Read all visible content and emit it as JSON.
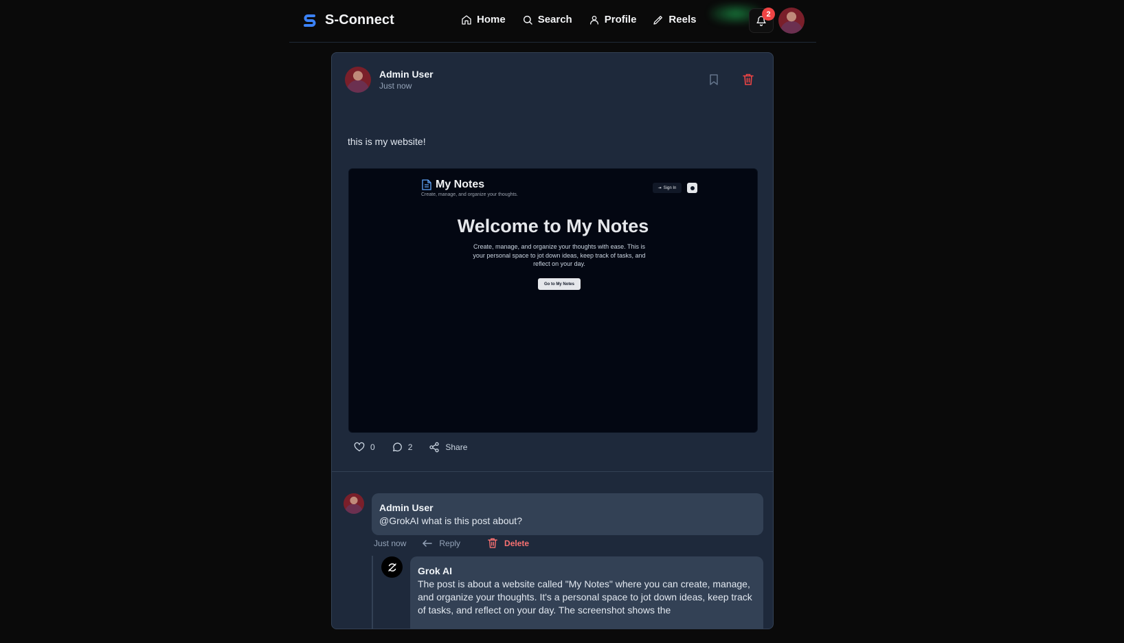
{
  "header": {
    "brand": "S-Connect",
    "nav": [
      {
        "label": "Home",
        "icon": "home-icon"
      },
      {
        "label": "Search",
        "icon": "search-icon"
      },
      {
        "label": "Profile",
        "icon": "user-icon"
      },
      {
        "label": "Reels",
        "icon": "pen-icon"
      }
    ],
    "notification_count": "2"
  },
  "post": {
    "author": "Admin User",
    "time": "Just now",
    "text": "this is my website!",
    "likes": "0",
    "comments": "2",
    "share_label": "Share"
  },
  "embedded": {
    "app_title": "My Notes",
    "app_subtitle": "Create, manage, and organize your thoughts.",
    "signin_label": "Sign In",
    "heading": "Welcome to My Notes",
    "body": "Create, manage, and organize your thoughts with ease. This is your personal space to jot down ideas, keep track of tasks, and reflect on your day.",
    "button": "Go to My Notes"
  },
  "comment": {
    "author": "Admin User",
    "text": "@GrokAI what is this post about?",
    "time": "Just now",
    "reply_label": "Reply",
    "delete_label": "Delete"
  },
  "reply": {
    "author": "Grok AI",
    "text": "The post is about a website called \"My Notes\" where you can create, manage, and organize your thoughts. It's a personal space to jot down ideas, keep track of tasks, and reflect on your day. The screenshot shows the"
  },
  "colors": {
    "accent": "#3b82f6",
    "danger": "#ef4444",
    "card": "#1e293b"
  }
}
